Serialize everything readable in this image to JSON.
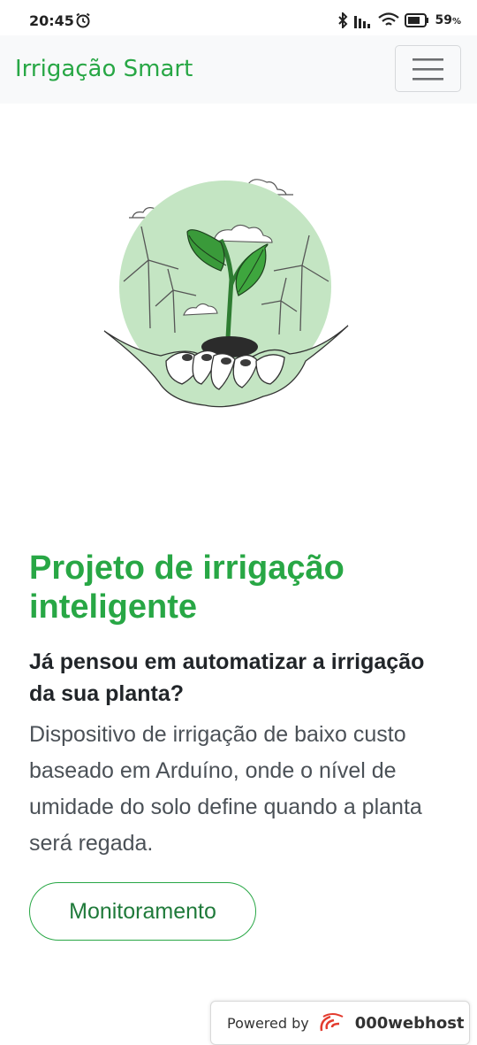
{
  "status_bar": {
    "time": "20:45",
    "battery_percent": "59",
    "battery_unit": "%"
  },
  "navbar": {
    "brand": "Irrigação Smart",
    "menu_icon": "hamburger-icon"
  },
  "hero": {
    "illustration": "hands-holding-sprout-with-wind-turbines",
    "colors": {
      "leaf": "#3a9a3a",
      "circle": "#bfe3bf",
      "outline": "#333333"
    }
  },
  "content": {
    "title": "Projeto de irrigação inteligente",
    "subtitle": "Já pensou em automatizar a irrigação da sua planta?",
    "description": "Dispositivo de irrigação de baixo custo baseado em Arduíno, onde o nível de umidade do solo define quando a planta será regada.",
    "button_label": "Monitoramento"
  },
  "footer": {
    "powered_label": "Powered by",
    "powered_brand": "000webhost"
  },
  "colors": {
    "accent": "#28a745",
    "navbar_bg": "#f8f9fa",
    "text": "#212529"
  }
}
